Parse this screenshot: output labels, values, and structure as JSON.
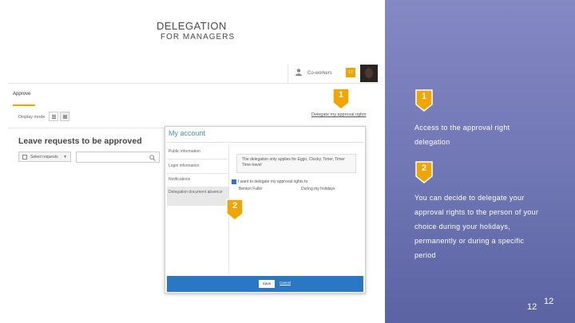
{
  "slide": {
    "title": "DELEGATION",
    "subtitle": "FOR MANAGERS",
    "page_number_large": "12",
    "page_number_small": "12"
  },
  "app": {
    "topbar": {
      "coworkers_label": "Co-workers",
      "badge_count": "17"
    },
    "tabs": {
      "approve": "Approve"
    },
    "delegate_link": "Delegate my approval rights",
    "display_mode_label": "Display mode",
    "page_title": "Leave requests to be approved",
    "select_label": "Select requests",
    "accent_color": "#f0a500",
    "link_color": "#2a78c4"
  },
  "modal": {
    "title": "My account",
    "menu": [
      "Public information",
      "Login information",
      "Notifications",
      "Delegation document absence"
    ],
    "info_text": "The delegation only applies for Eggo, Clocky, Timer, Timer Time travel",
    "checkbox_label": "I want to delegate my approval rights to",
    "field_person": "Benton Fuller",
    "field_period": "During my holidays",
    "save_label": "Save",
    "cancel_label": "Cancel"
  },
  "markers": [
    "1",
    "2",
    "1",
    "2"
  ],
  "panel": {
    "step1_text_line1": "Access to the approval right",
    "step1_text_line2": "delegation",
    "step2_lines": [
      "You can decide to delegate your",
      "approval rights to the person of your",
      "choice during your holidays,",
      "permanently or during a specific",
      "period"
    ],
    "marker_color": "#f0a500"
  }
}
